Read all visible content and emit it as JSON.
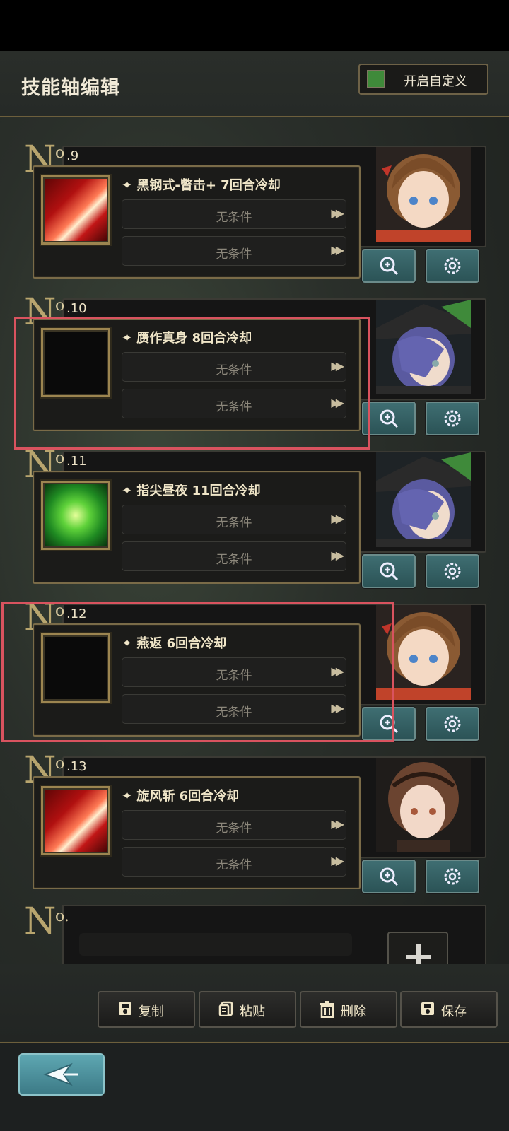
{
  "header": {
    "title": "技能轴编辑",
    "toggle_label": "开启自定义"
  },
  "entries": [
    {
      "num_prefix": "N",
      "num_o": "o",
      "num": ".9",
      "skill": "黑钢式-瞥击+ 7回合冷却",
      "icon": "red-slash-skill-icon",
      "conditions": [
        "无条件",
        "无条件"
      ],
      "portrait": "brown-hair-girl"
    },
    {
      "num_prefix": "N",
      "num_o": "o",
      "num": ".10",
      "skill": "赝作真身 8回合冷却",
      "icon": "empty-skill-slot",
      "conditions": [
        "无条件",
        "无条件"
      ],
      "portrait": "purple-hair-witch"
    },
    {
      "num_prefix": "N",
      "num_o": "o",
      "num": ".11",
      "skill": "指尖昼夜 11回合冷却",
      "icon": "green-tornado-skill-icon",
      "conditions": [
        "无条件",
        "无条件"
      ],
      "portrait": "purple-hair-witch"
    },
    {
      "num_prefix": "N",
      "num_o": "o",
      "num": ".12",
      "skill": "燕返 6回合冷却",
      "icon": "empty-skill-slot",
      "conditions": [
        "无条件",
        "无条件"
      ],
      "portrait": "brown-hair-girl"
    },
    {
      "num_prefix": "N",
      "num_o": "o",
      "num": ".13",
      "skill": "旋风斩 6回合冷却",
      "icon": "red-slash-skill-icon",
      "conditions": [
        "无条件",
        "无条件"
      ],
      "portrait": "brown-hair-lady"
    }
  ],
  "empty_entry": {
    "num_prefix": "N",
    "num_o": "o."
  },
  "actions": {
    "copy": "复制",
    "paste": "粘贴",
    "delete": "删除",
    "save": "保存"
  },
  "colors": {
    "highlight": "#d9535f",
    "gold": "#b8a56e",
    "teal_button": "#3f6e72"
  }
}
